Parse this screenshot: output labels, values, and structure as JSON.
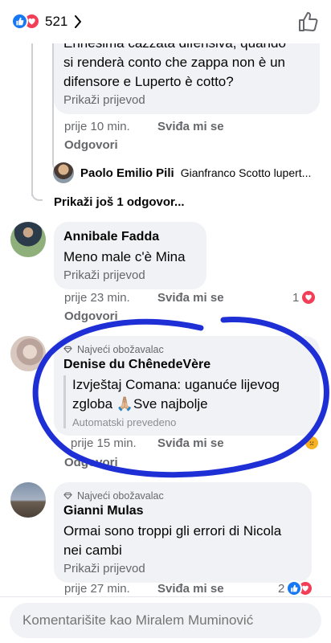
{
  "header": {
    "reaction_count": "521"
  },
  "comments": [
    {
      "text": "Ennesima cazzata difensiva, quando si renderà conto che zappa non è un difensore e Luperto è cotto?",
      "text_line1": "Ennesima cazzata difensiva, quando",
      "text_line2": "si renderà conto che zappa non è un",
      "text_line3": "difensore e Luperto è cotto?",
      "translate": "Prikaži prijevod",
      "time": "prije 10 min.",
      "like": "Sviđa mi se",
      "reply": "Odgovori"
    },
    {
      "author": "Annibale Fadda",
      "text": "Meno male c'è Mina",
      "translate": "Prikaži prijevod",
      "time": "prije 23 min.",
      "like": "Sviđa mi se",
      "reply": "Odgovori",
      "reaction_count": "1"
    },
    {
      "badge": "Najveći obožavalac",
      "author": "Denise du ChênedeVère",
      "text_line1": "Izvještaj Comana: uganuće lijevog",
      "text_line2": "zgloba 🙏🏼Sve najbolje",
      "auto": "Automatski prevedeno",
      "time": "prije 15 min.",
      "like": "Sviđa mi se",
      "reply": "Odgovori"
    },
    {
      "badge": "Najveći obožavalac",
      "author": "Gianni Mulas",
      "text_line1": "Ormai sono troppi gli errori di Nicola",
      "text_line2": "nei cambi",
      "translate": "Prikaži prijevod",
      "time": "prije 27 min.",
      "like": "Sviđa mi se",
      "reaction_count": "2"
    }
  ],
  "subreply": {
    "author": "Paolo Emilio Pili",
    "preview": "Gianfranco Scotto lupert..."
  },
  "more_replies": "Prikaži još 1 odgovor...",
  "composer": {
    "placeholder": "Komentarišite kao Miralem Muminović"
  },
  "colors": {
    "like_blue": "#1877f2",
    "love_red": "#f33e58",
    "annotation": "#1f2fd6",
    "bubble": "#f0f2f5",
    "muted": "#65676b"
  },
  "icons": [
    "like-reaction-icon",
    "love-reaction-icon",
    "chevron-right-icon",
    "thumbs-up-icon",
    "diamond-badge-icon",
    "sad-reaction-icon"
  ]
}
